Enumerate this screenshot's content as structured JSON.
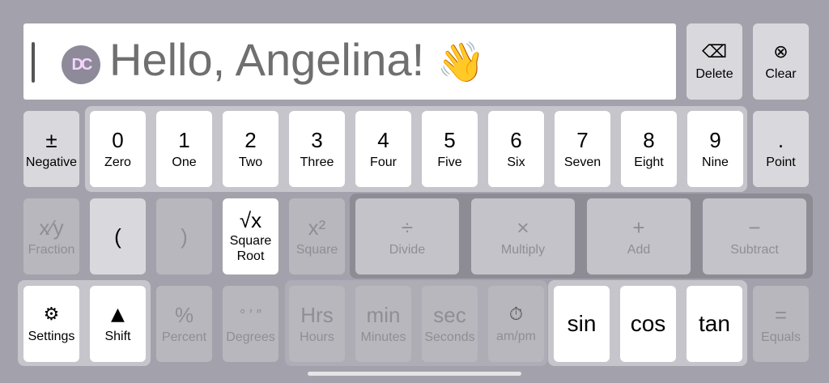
{
  "display": {
    "logo_text": "DC",
    "greeting": "Hello, Angelina!",
    "wave_emoji": "👋"
  },
  "top_keys": {
    "delete": {
      "icon": "⌫",
      "label": "Delete"
    },
    "clear": {
      "icon": "⊗",
      "label": "Clear"
    }
  },
  "row1": {
    "negative": {
      "sym": "±",
      "label": "Negative"
    },
    "digits": [
      {
        "sym": "0",
        "label": "Zero"
      },
      {
        "sym": "1",
        "label": "One"
      },
      {
        "sym": "2",
        "label": "Two"
      },
      {
        "sym": "3",
        "label": "Three"
      },
      {
        "sym": "4",
        "label": "Four"
      },
      {
        "sym": "5",
        "label": "Five"
      },
      {
        "sym": "6",
        "label": "Six"
      },
      {
        "sym": "7",
        "label": "Seven"
      },
      {
        "sym": "8",
        "label": "Eight"
      },
      {
        "sym": "9",
        "label": "Nine"
      }
    ],
    "point": {
      "sym": ".",
      "label": "Point"
    }
  },
  "row2": {
    "fraction": {
      "sym": "x⁄y",
      "label": "Fraction"
    },
    "open_paren": {
      "sym": "("
    },
    "close_paren": {
      "sym": ")"
    },
    "sqrt": {
      "sym": "√x",
      "label_line1": "Square",
      "label_line2": "Root"
    },
    "square": {
      "sym": "x²",
      "label": "Square"
    },
    "divide": {
      "sym": "÷",
      "label": "Divide"
    },
    "multiply": {
      "sym": "×",
      "label": "Multiply"
    },
    "add": {
      "sym": "+",
      "label": "Add"
    },
    "subtract": {
      "sym": "−",
      "label": "Subtract"
    }
  },
  "row3": {
    "settings": {
      "icon": "⚙",
      "label": "Settings"
    },
    "shift": {
      "icon": "▲",
      "label": "Shift"
    },
    "percent": {
      "sym": "%",
      "label": "Percent"
    },
    "degrees": {
      "sym": "° ′ ″",
      "label": "Degrees"
    },
    "hours": {
      "sym": "Hrs",
      "label": "Hours"
    },
    "minutes": {
      "sym": "min",
      "label": "Minutes"
    },
    "seconds": {
      "sym": "sec",
      "label": "Seconds"
    },
    "ampm": {
      "icon": "⏱",
      "label": "am/pm"
    },
    "sin": {
      "sym": "sin"
    },
    "cos": {
      "sym": "cos"
    },
    "tan": {
      "sym": "tan"
    },
    "equals": {
      "sym": "=",
      "label": "Equals"
    }
  }
}
